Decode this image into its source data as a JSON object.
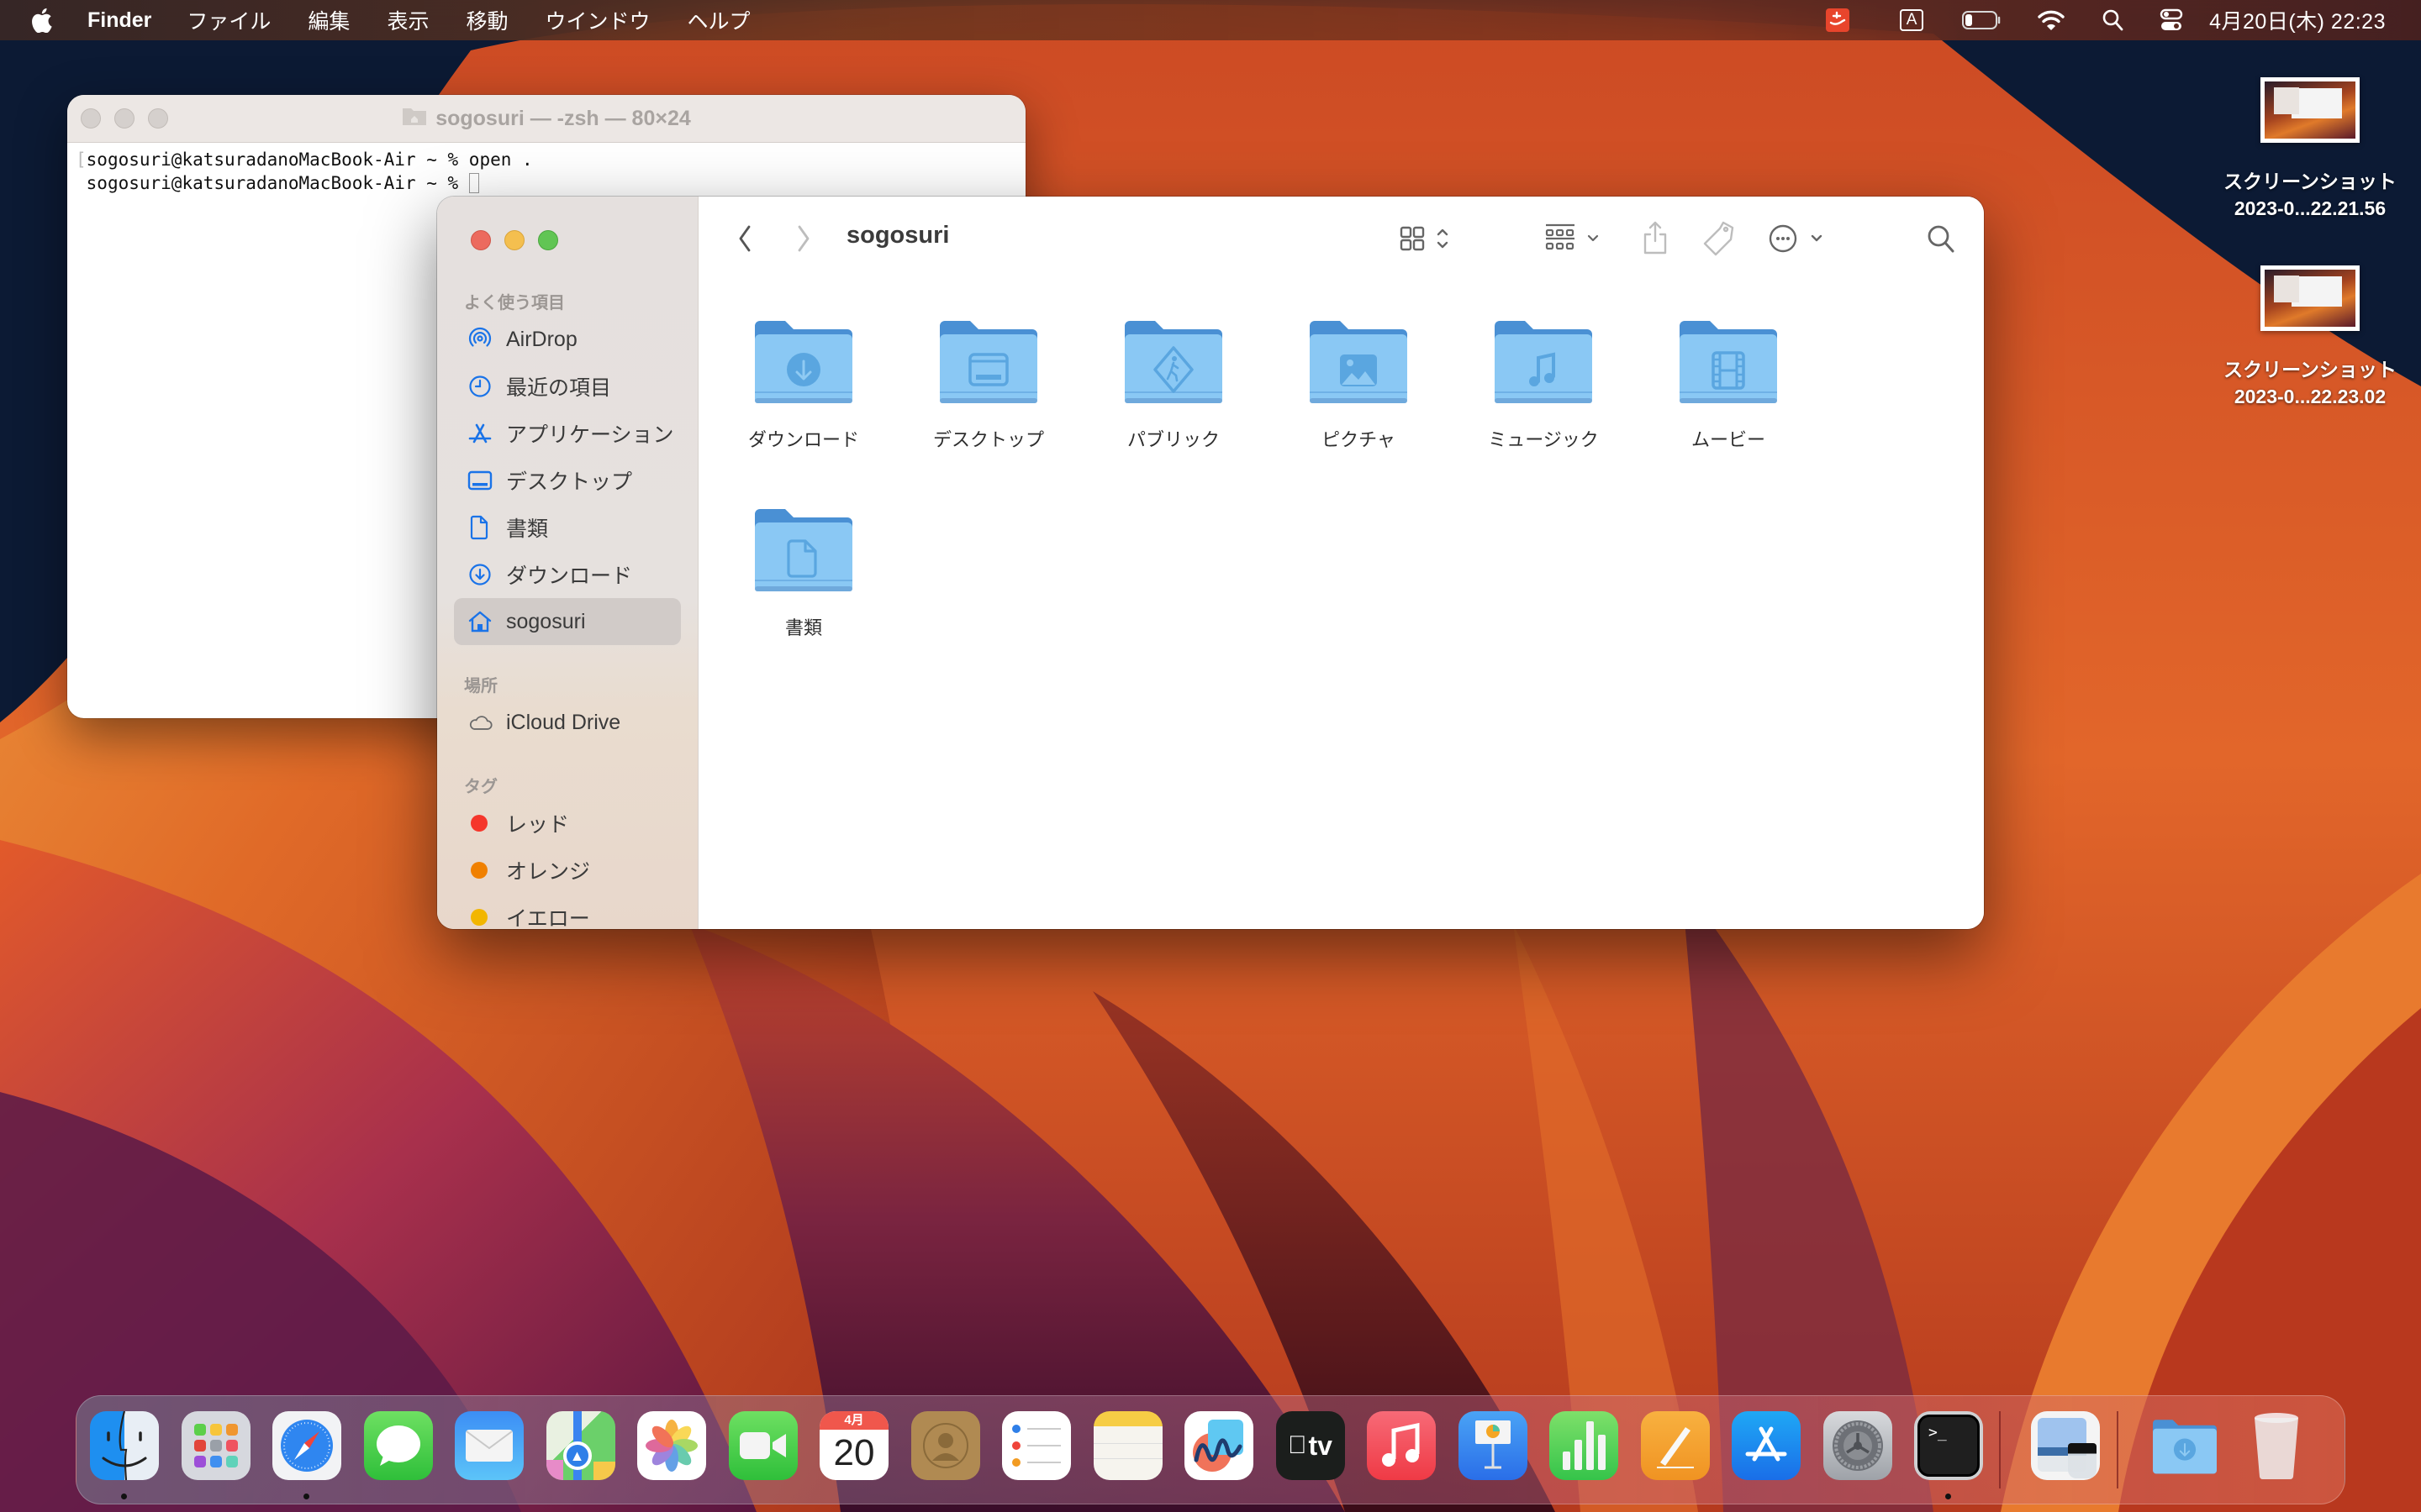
{
  "menubar": {
    "app_name": "Finder",
    "menus": [
      "ファイル",
      "編集",
      "表示",
      "移動",
      "ウインドウ",
      "ヘルプ"
    ],
    "status_icons": [
      "app-extension-icon",
      "input-method-icon",
      "battery-icon",
      "wifi-icon",
      "spotlight-search-icon",
      "control-center-icon"
    ],
    "input_method_label": "A",
    "clock": "4月20日(木)  22:23"
  },
  "desktop": {
    "files": [
      {
        "name_line1": "スクリーンショット",
        "name_line2": "2023-0...22.21.56"
      },
      {
        "name_line1": "スクリーンショット",
        "name_line2": "2023-0...22.23.02"
      }
    ]
  },
  "terminal": {
    "title": "sogosuri — -zsh — 80×24",
    "lines": [
      "sogosuri@katsuradanoMacBook-Air ~ % open .",
      "sogosuri@katsuradanoMacBook-Air ~ % "
    ]
  },
  "finder": {
    "current_folder": "sogosuri",
    "sidebar": {
      "favorites_label": "よく使う項目",
      "favorites": [
        {
          "label": "AirDrop",
          "icon": "airdrop-icon"
        },
        {
          "label": "最近の項目",
          "icon": "clock-icon"
        },
        {
          "label": "アプリケーション",
          "icon": "applications-icon"
        },
        {
          "label": "デスクトップ",
          "icon": "desktop-icon"
        },
        {
          "label": "書類",
          "icon": "document-icon"
        },
        {
          "label": "ダウンロード",
          "icon": "download-icon"
        },
        {
          "label": "sogosuri",
          "icon": "home-icon",
          "selected": true
        }
      ],
      "locations_label": "場所",
      "locations": [
        {
          "label": "iCloud Drive",
          "icon": "cloud-icon"
        }
      ],
      "tags_label": "タグ",
      "tags": [
        {
          "label": "レッド",
          "color": "#f5362b"
        },
        {
          "label": "オレンジ",
          "color": "#f08000"
        },
        {
          "label": "イエロー",
          "color": "#f2b600"
        }
      ]
    },
    "toolbar": {
      "back": "back-icon",
      "forward": "forward-icon",
      "view_mode": "icon-view",
      "group": "group-by-icon",
      "share": "share-icon",
      "tag": "tag-icon",
      "more": "more-actions-icon",
      "search": "search-icon"
    },
    "items": [
      {
        "label": "ダウンロード",
        "glyph": "download"
      },
      {
        "label": "デスクトップ",
        "glyph": "desktop"
      },
      {
        "label": "パブリック",
        "glyph": "public"
      },
      {
        "label": "ピクチャ",
        "glyph": "pictures"
      },
      {
        "label": "ミュージック",
        "glyph": "music"
      },
      {
        "label": "ムービー",
        "glyph": "movies"
      },
      {
        "label": "書類",
        "glyph": "document"
      }
    ]
  },
  "dock": {
    "apps": [
      {
        "name": "Finder",
        "running": true
      },
      {
        "name": "Launchpad",
        "running": false
      },
      {
        "name": "Safari",
        "running": true
      },
      {
        "name": "Messages",
        "running": false
      },
      {
        "name": "Mail",
        "running": false
      },
      {
        "name": "Maps",
        "running": false
      },
      {
        "name": "Photos",
        "running": false
      },
      {
        "name": "FaceTime",
        "running": false
      },
      {
        "name": "Calendar",
        "running": false,
        "month": "4月",
        "day": "20"
      },
      {
        "name": "Contacts",
        "running": false
      },
      {
        "name": "Reminders",
        "running": false
      },
      {
        "name": "Notes",
        "running": false
      },
      {
        "name": "Freeform",
        "running": false
      },
      {
        "name": "TV",
        "running": false,
        "label": "tv"
      },
      {
        "name": "Music",
        "running": false
      },
      {
        "name": "Keynote",
        "running": false
      },
      {
        "name": "Numbers",
        "running": false
      },
      {
        "name": "Pages",
        "running": false
      },
      {
        "name": "App Store",
        "running": false
      },
      {
        "name": "System Settings",
        "running": false
      },
      {
        "name": "Terminal",
        "running": true,
        "label": ">_"
      },
      {
        "name": "Preview",
        "running": false
      },
      {
        "name": "Downloads",
        "running": false
      },
      {
        "name": "Trash",
        "running": false
      }
    ]
  }
}
